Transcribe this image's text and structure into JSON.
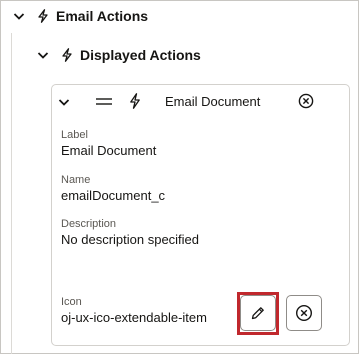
{
  "tree": {
    "group": {
      "label": "Email Actions",
      "expanded": true
    },
    "subgroup": {
      "label": "Displayed Actions",
      "expanded": true
    }
  },
  "card": {
    "title": "Email Document",
    "fields": {
      "label": {
        "label": "Label",
        "value": "Email Document"
      },
      "name": {
        "label": "Name",
        "value": "emailDocument_c"
      },
      "description": {
        "label": "Description",
        "value": "No description specified"
      },
      "icon": {
        "label": "Icon",
        "value": "oj-ux-ico-extendable-item"
      }
    }
  },
  "icons": {
    "chevron": "chevron-down-icon",
    "bolt": "lightning-bolt-icon",
    "drag": "drag-handle-icon",
    "remove": "remove-circle-icon",
    "edit": "pencil-icon"
  },
  "colors": {
    "highlight": "#c0282d",
    "text": "#161513",
    "muted": "#5b5853"
  }
}
